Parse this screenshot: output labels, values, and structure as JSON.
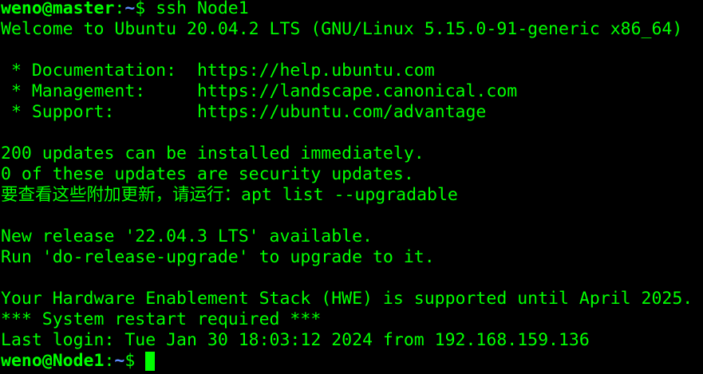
{
  "prompt1": {
    "user_host": "weno@master",
    "separator": ":",
    "path": "~",
    "dollar": "$ ",
    "command": "ssh Node1"
  },
  "motd": {
    "welcome": "Welcome to Ubuntu 20.04.2 LTS (GNU/Linux 5.15.0-91-generic x86_64)",
    "documentation": " * Documentation:  https://help.ubuntu.com",
    "management": " * Management:     https://landscape.canonical.com",
    "support": " * Support:        https://ubuntu.com/advantage",
    "updates_available": "200 updates can be installed immediately.",
    "security_updates": "0 of these updates are security updates.",
    "list_hint_cjk": "要查看这些附加更新，请运行：",
    "list_hint_cmd": "apt list --upgradable",
    "new_release": "New release '22.04.3 LTS' available.",
    "upgrade_hint": "Run 'do-release-upgrade' to upgrade to it.",
    "hwe_support": "Your Hardware Enablement Stack (HWE) is supported until April 2025.",
    "restart_required": "*** System restart required ***",
    "last_login": "Last login: Tue Jan 30 18:03:12 2024 from 192.168.159.136"
  },
  "prompt2": {
    "user_host": "weno@Node1",
    "separator": ":",
    "path": "~",
    "dollar": "$ "
  },
  "colors": {
    "background": "#000000",
    "text": "#00ff00",
    "path": "#5c8cff"
  }
}
